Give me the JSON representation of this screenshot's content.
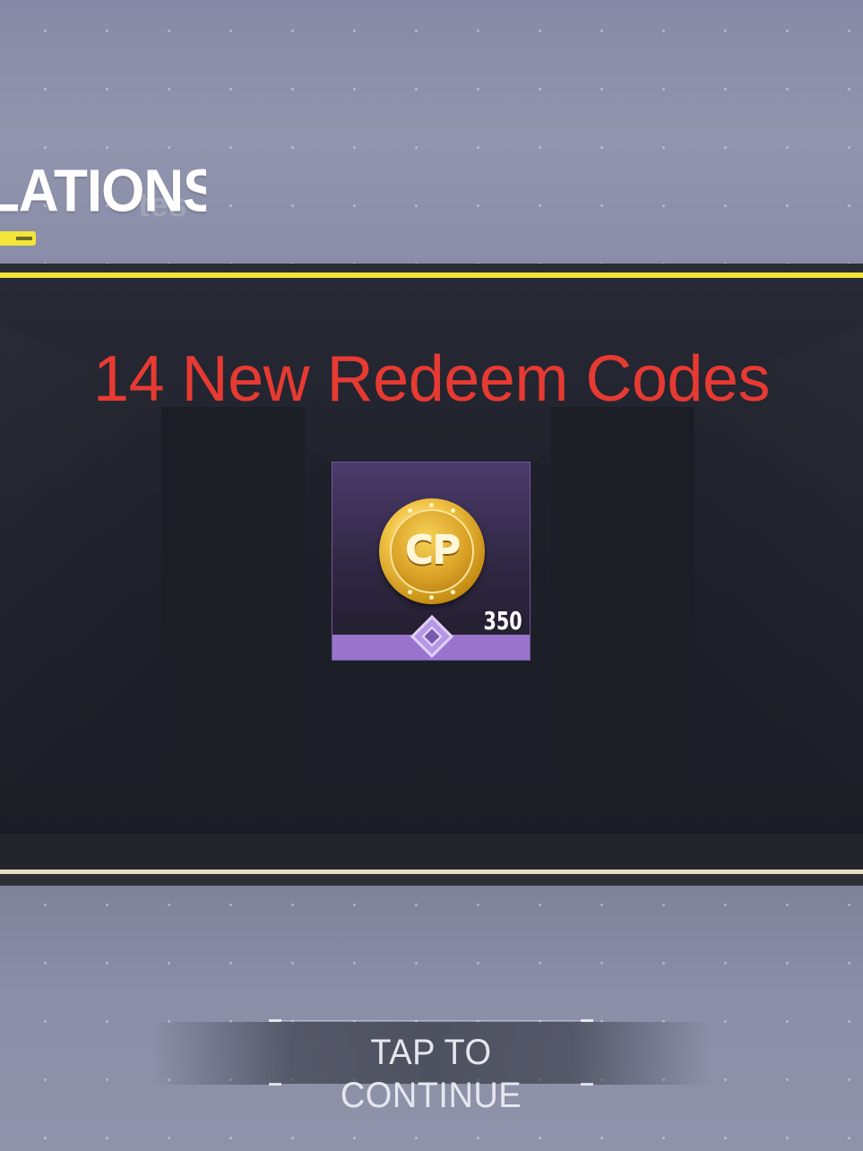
{
  "header": {
    "title_fragment": "ATIONS!",
    "ghost_fragment": "tes"
  },
  "overlay": {
    "headline": "14 New Redeem Codes"
  },
  "reward": {
    "currency_label": "CP",
    "quantity": "350",
    "rarity": "epic",
    "icon": "cp-coin-icon"
  },
  "footer": {
    "continue_label": "TAP TO CONTINUE"
  },
  "colors": {
    "accent_yellow": "#f1e23a",
    "headline_red": "#e63a32",
    "rarity_purple": "#9a74cc",
    "panel_dark": "#1a1c24"
  }
}
